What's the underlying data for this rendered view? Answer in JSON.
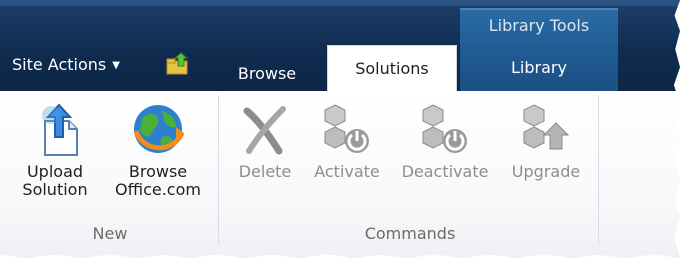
{
  "header": {
    "site_actions_label": "Site Actions",
    "site_actions_caret": "▼",
    "navigate_icon": "folder-up-arrow-icon",
    "tabs": [
      {
        "label": "Browse",
        "active": false
      },
      {
        "label": "Solutions",
        "active": true
      }
    ],
    "contextual_group": {
      "label": "Library Tools",
      "tab_label": "Library",
      "color": "#1f5a92"
    },
    "background": "#0f2b4e"
  },
  "ribbon": {
    "groups": [
      {
        "label": "New",
        "buttons": [
          {
            "label_line1": "Upload",
            "label_line2": "Solution",
            "icon": "upload-solution-icon",
            "enabled": true
          },
          {
            "label_line1": "Browse",
            "label_line2": "Office.com",
            "icon": "globe-icon",
            "enabled": true
          }
        ]
      },
      {
        "label": "Commands",
        "buttons": [
          {
            "label": "Delete",
            "icon": "delete-x-icon",
            "enabled": false
          },
          {
            "label": "Activate",
            "icon": "activate-cubes-icon",
            "enabled": false
          },
          {
            "label": "Deactivate",
            "icon": "deactivate-cubes-icon",
            "enabled": false
          },
          {
            "label": "Upgrade",
            "icon": "upgrade-cubes-icon",
            "enabled": false
          }
        ]
      }
    ]
  }
}
